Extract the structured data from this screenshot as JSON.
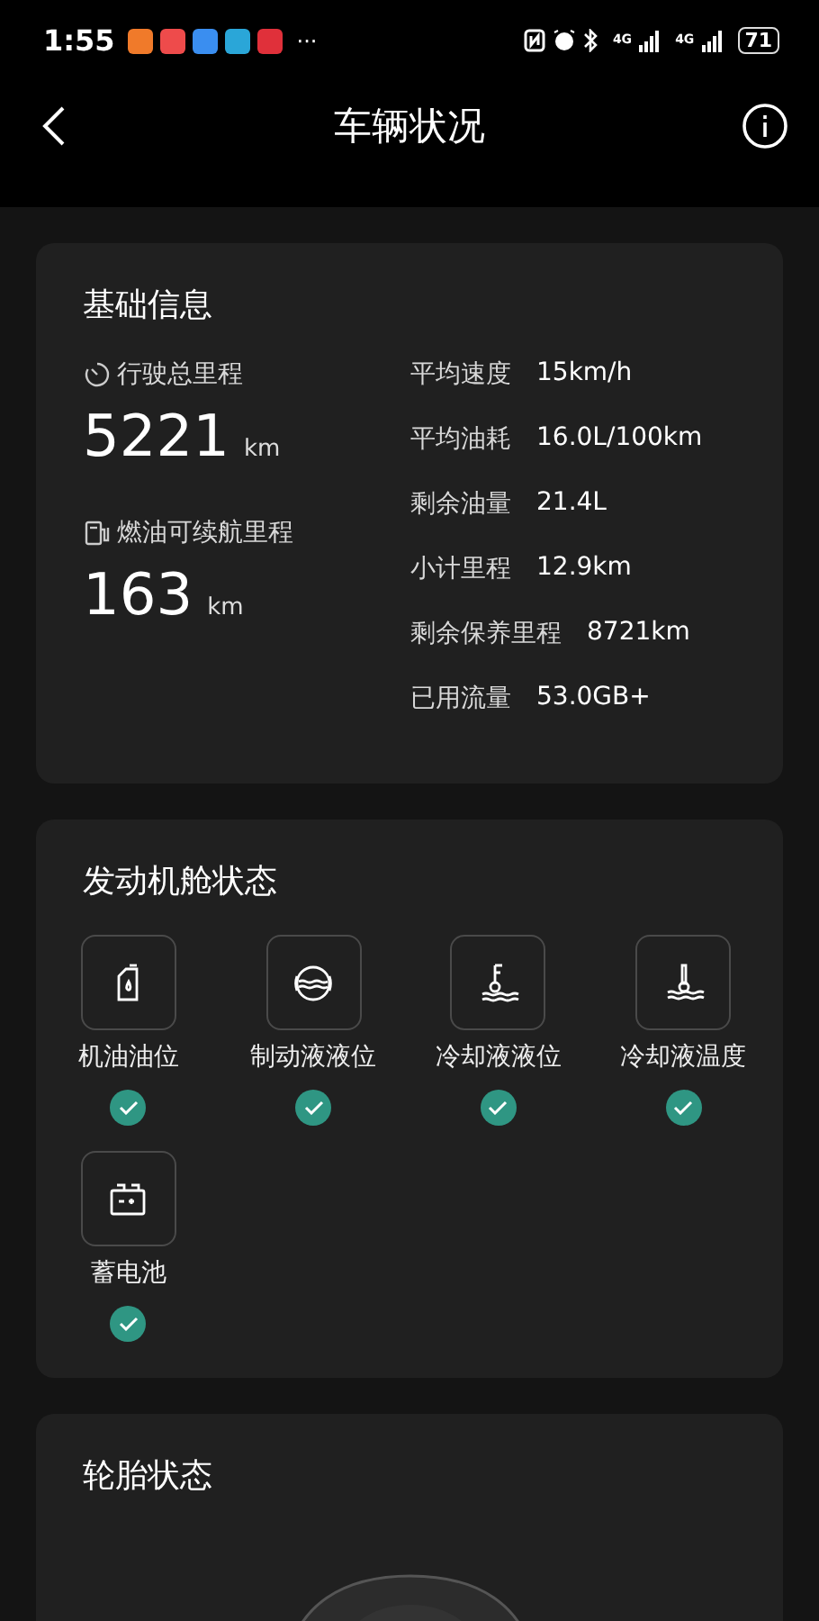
{
  "status_bar": {
    "time": "1:55",
    "more": "···",
    "network_labels": [
      "4G",
      "4G"
    ],
    "battery": "71",
    "app_icons": [
      {
        "color": "#f07a2a"
      },
      {
        "color": "#ee4b4b"
      },
      {
        "color": "#3a8ef0"
      },
      {
        "color": "#2aa6d8"
      },
      {
        "color": "#e0303a"
      }
    ]
  },
  "header": {
    "title": "车辆状况"
  },
  "basic_info": {
    "title": "基础信息",
    "main_stats": [
      {
        "kind": "odometer",
        "label": "行驶总里程",
        "value": "5221",
        "unit": "km"
      },
      {
        "kind": "fuel",
        "label": "燃油可续航里程",
        "value": "163",
        "unit": "km"
      }
    ],
    "details": [
      {
        "label": "平均速度",
        "value": "15km/h"
      },
      {
        "label": "平均油耗",
        "value": "16.0L/100km"
      },
      {
        "label": "剩余油量",
        "value": "21.4L"
      },
      {
        "label": "小计里程",
        "value": "12.9km"
      },
      {
        "label": "剩余保养里程",
        "value": "8721km"
      },
      {
        "label": "已用流量",
        "value": "53.0GB+"
      }
    ]
  },
  "engine_bay": {
    "title": "发动机舱状态",
    "items": [
      {
        "kind": "oil",
        "label": "机油油位",
        "ok": true
      },
      {
        "kind": "brake",
        "label": "制动液液位",
        "ok": true
      },
      {
        "kind": "coolant_level",
        "label": "冷却液液位",
        "ok": true
      },
      {
        "kind": "coolant_temp",
        "label": "冷却液温度",
        "ok": true
      },
      {
        "kind": "battery",
        "label": "蓄电池",
        "ok": true
      }
    ]
  },
  "tires": {
    "title": "轮胎状态"
  }
}
